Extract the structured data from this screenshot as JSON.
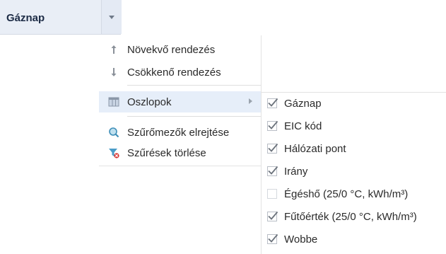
{
  "column_header": {
    "title": "Gáznap"
  },
  "menu": {
    "items": [
      {
        "label": "Növekvő rendezés",
        "icon": "sort-ascending-icon"
      },
      {
        "label": "Csökkenő rendezés",
        "icon": "sort-descending-icon"
      },
      {
        "label": "Oszlopok",
        "icon": "columns-icon",
        "has_submenu": true
      },
      {
        "label": "Szűrőmezők elrejtése",
        "icon": "search-filter-icon"
      },
      {
        "label": "Szűrések törlése",
        "icon": "clear-filter-icon"
      }
    ]
  },
  "columns_submenu": {
    "items": [
      {
        "label": "Gáznap",
        "checked": true
      },
      {
        "label": "EIC kód",
        "checked": true
      },
      {
        "label": "Hálózati pont",
        "checked": true
      },
      {
        "label": "Irány",
        "checked": true
      },
      {
        "label": "Égéshő (25/0 °C, kWh/m³)",
        "checked": false
      },
      {
        "label": "Fűtőérték (25/0 °C, kWh/m³)",
        "checked": true
      },
      {
        "label": "Wobbe",
        "checked": true
      }
    ]
  },
  "colors": {
    "header_bg": "#e9eef6",
    "active_bg": "#e6eef9",
    "check_color": "#6c737c"
  }
}
